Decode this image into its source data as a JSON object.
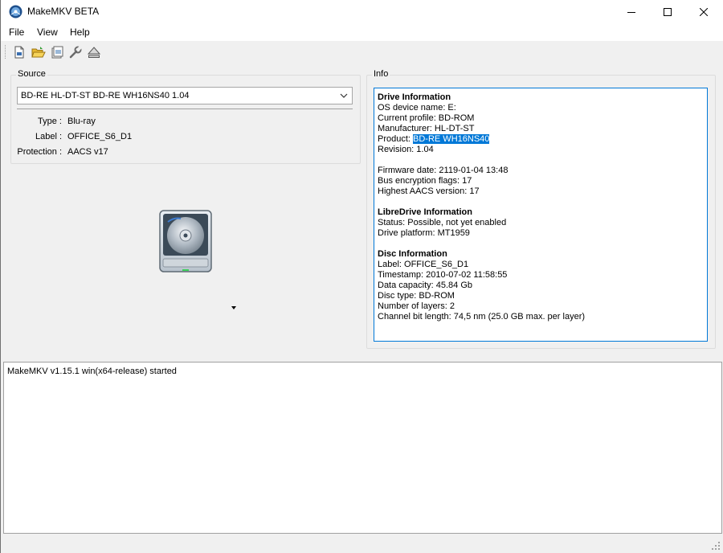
{
  "window": {
    "title": "MakeMKV BETA"
  },
  "menu": {
    "items": [
      "File",
      "View",
      "Help"
    ]
  },
  "toolbar": {
    "icons": [
      "open-files-icon",
      "open-folder-icon",
      "backup-icon",
      "settings-icon",
      "eject-icon"
    ]
  },
  "source": {
    "group_label": "Source",
    "selected_drive": "BD-RE HL-DT-ST BD-RE  WH16NS40 1.04",
    "fields": [
      {
        "label": "Type :",
        "value": "Blu-ray"
      },
      {
        "label": "Label :",
        "value": "OFFICE_S6_D1"
      },
      {
        "label": "Protection :",
        "value": "AACS v17"
      }
    ]
  },
  "info": {
    "group_label": "Info",
    "drive_heading": "Drive Information",
    "os_device": "OS device name: E:",
    "current_profile": "Current profile: BD-ROM",
    "manufacturer": "Manufacturer: HL-DT-ST",
    "product_label": "Product: ",
    "product_value": "BD-RE WH16NS40",
    "revision": "Revision: 1.04",
    "firmware_date": "Firmware date: 2119-01-04 13:48",
    "bus_encryption": "Bus encryption flags: 17",
    "highest_aacs": "Highest AACS version: 17",
    "libre_heading": "LibreDrive Information",
    "libre_status": "Status: Possible, not yet enabled",
    "libre_platform": "Drive platform: MT1959",
    "disc_heading": "Disc Information",
    "disc_label": "Label: OFFICE_S6_D1",
    "disc_timestamp": "Timestamp: 2010-07-02 11:58:55",
    "disc_capacity": "Data capacity: 45.84 Gb",
    "disc_type": "Disc type: BD-ROM",
    "disc_layers": "Number of layers: 2",
    "disc_bitlength": "Channel bit length: 74,5 nm (25.0 GB max. per layer)"
  },
  "log": {
    "lines": [
      "MakeMKV v1.15.1 win(x64-release) started"
    ]
  },
  "colors": {
    "selection": "#0078d7",
    "focus_border": "#0078d7",
    "window_bg": "#f0f0f0"
  }
}
